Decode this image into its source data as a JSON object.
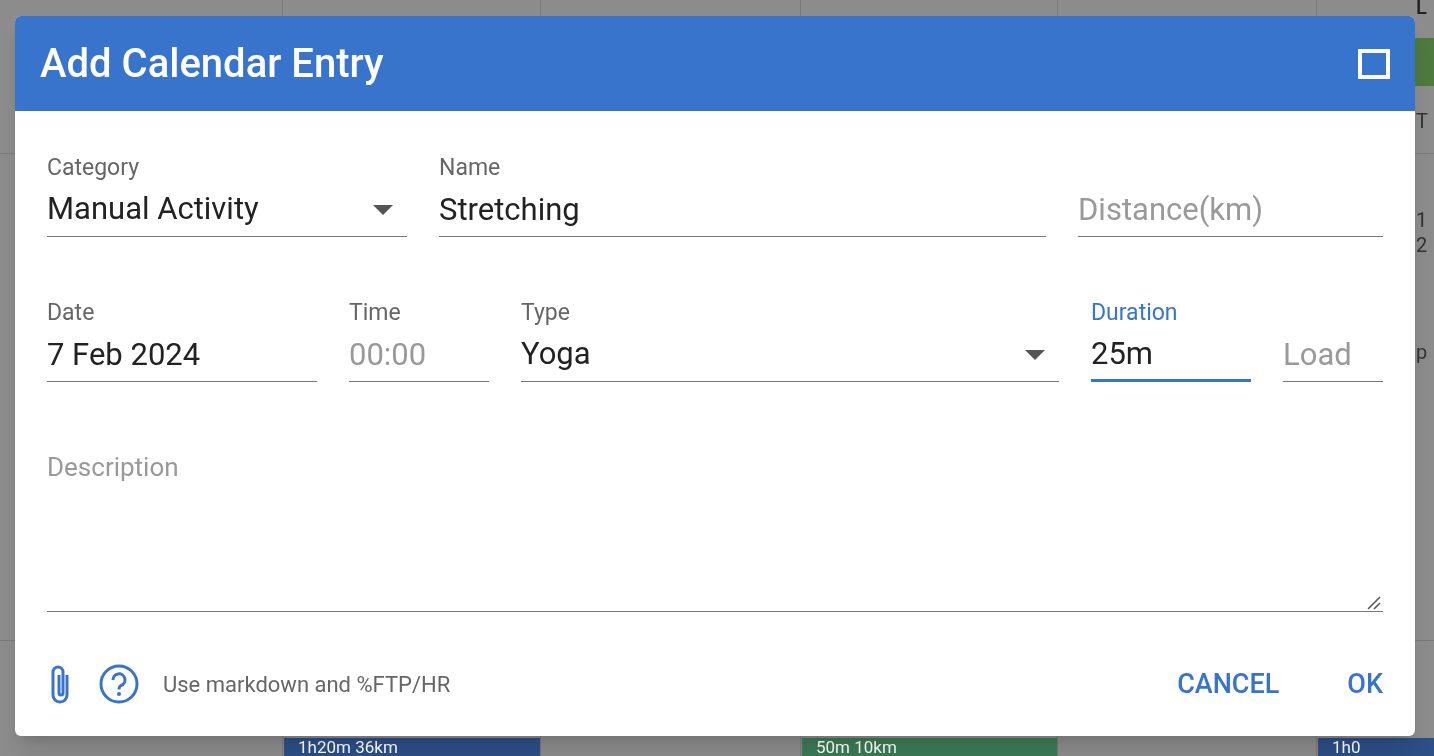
{
  "background": {
    "corner_label": "L",
    "side_texts": [
      "T",
      "1",
      "2",
      "p"
    ],
    "events": [
      {
        "text": "1h20m  36km",
        "color": "#2d4f86"
      },
      {
        "text": "50m  10km",
        "color": "#3c7a55"
      },
      {
        "text": "1h0",
        "color": "#2d4f86"
      }
    ]
  },
  "dialog": {
    "title": "Add Calendar Entry",
    "top_fields": [
      {
        "kind": "select",
        "label": "Category",
        "value": "Manual Activity",
        "focused": false
      },
      {
        "kind": "text",
        "label": "Name",
        "value": "Stretching",
        "focused": false
      },
      {
        "kind": "text",
        "placeholder": "Distance(km)",
        "focused": false
      }
    ],
    "bottom_fields": [
      {
        "kind": "text",
        "label": "Date",
        "value": "7 Feb 2024",
        "focused": false
      },
      {
        "kind": "text",
        "label": "Time",
        "placeholder": "00:00",
        "focused": false
      },
      {
        "kind": "select",
        "label": "Type",
        "value": "Yoga",
        "focused": false
      },
      {
        "kind": "text",
        "label": "Duration",
        "value": "25m",
        "focused": true
      },
      {
        "kind": "text",
        "placeholder": "Load",
        "focused": false
      }
    ],
    "description": {
      "placeholder": "Description"
    },
    "hint": "Use markdown and %FTP/HR",
    "buttons": [
      "CANCEL",
      "OK"
    ]
  }
}
